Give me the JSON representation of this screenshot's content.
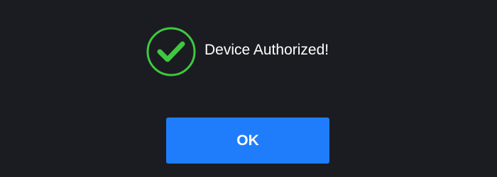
{
  "dialog": {
    "message": "Device Authorized!",
    "icon": "check-circle-icon",
    "ok_label": "OK"
  },
  "colors": {
    "background": "#1b1c22",
    "success": "#3ec93e",
    "button": "#1f7dfb",
    "text": "#ffffff"
  }
}
